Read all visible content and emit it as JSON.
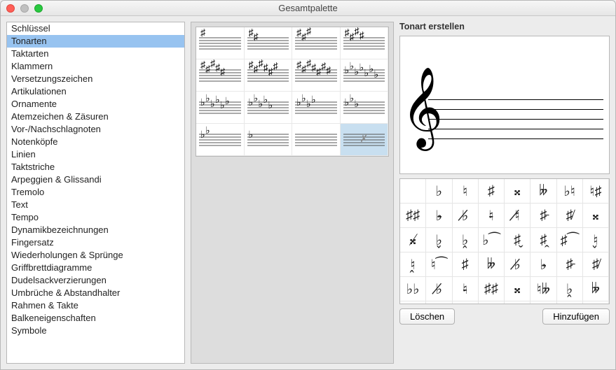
{
  "window": {
    "title": "Gesamtpalette"
  },
  "sidebar": {
    "items": [
      {
        "label": "Schlüssel",
        "selected": false
      },
      {
        "label": "Tonarten",
        "selected": true
      },
      {
        "label": "Taktarten",
        "selected": false
      },
      {
        "label": "Klammern",
        "selected": false
      },
      {
        "label": "Versetzungszeichen",
        "selected": false
      },
      {
        "label": "Artikulationen",
        "selected": false
      },
      {
        "label": "Ornamente",
        "selected": false
      },
      {
        "label": "Atemzeichen & Zäsuren",
        "selected": false
      },
      {
        "label": "Vor-/Nachschlagnoten",
        "selected": false
      },
      {
        "label": "Notenköpfe",
        "selected": false
      },
      {
        "label": "Linien",
        "selected": false
      },
      {
        "label": "Taktstriche",
        "selected": false
      },
      {
        "label": "Arpeggien & Glissandi",
        "selected": false
      },
      {
        "label": "Tremolo",
        "selected": false
      },
      {
        "label": "Text",
        "selected": false
      },
      {
        "label": "Tempo",
        "selected": false
      },
      {
        "label": "Dynamikbezeichnungen",
        "selected": false
      },
      {
        "label": "Fingersatz",
        "selected": false
      },
      {
        "label": "Wiederholungen & Sprünge",
        "selected": false
      },
      {
        "label": "Griffbrettdiagramme",
        "selected": false
      },
      {
        "label": "Dudelsackverzierungen",
        "selected": false
      },
      {
        "label": "Umbrüche & Abstandhalter",
        "selected": false
      },
      {
        "label": "Rahmen & Takte",
        "selected": false
      },
      {
        "label": "Balkeneigenschaften",
        "selected": false
      },
      {
        "label": "Symbole",
        "selected": false
      }
    ]
  },
  "palette": {
    "cells": [
      {
        "type": "sharp",
        "count": 1,
        "selected": false
      },
      {
        "type": "sharp",
        "count": 2,
        "selected": false
      },
      {
        "type": "sharp",
        "count": 3,
        "selected": false
      },
      {
        "type": "sharp",
        "count": 4,
        "selected": false
      },
      {
        "type": "sharp",
        "count": 5,
        "selected": false
      },
      {
        "type": "sharp",
        "count": 6,
        "selected": false
      },
      {
        "type": "sharp",
        "count": 7,
        "selected": false
      },
      {
        "type": "flat",
        "count": 7,
        "selected": false
      },
      {
        "type": "flat",
        "count": 6,
        "selected": false
      },
      {
        "type": "flat",
        "count": 5,
        "selected": false
      },
      {
        "type": "flat",
        "count": 4,
        "selected": false
      },
      {
        "type": "flat",
        "count": 3,
        "selected": false
      },
      {
        "type": "flat",
        "count": 2,
        "selected": false
      },
      {
        "type": "flat",
        "count": 1,
        "selected": false
      },
      {
        "type": "none",
        "count": 0,
        "selected": false
      },
      {
        "type": "custom",
        "count": 0,
        "selected": true
      }
    ]
  },
  "editor": {
    "heading": "Tonart erstellen",
    "clef_glyph": "𝄞"
  },
  "acc_picker": {
    "glyphs": [
      "",
      "♭",
      "♮",
      "♯",
      "𝄪",
      "𝄫",
      "♭♮",
      "♮♯",
      "♯♯",
      "♭̵",
      "♭̸",
      "♮̵",
      "♮̸",
      "♯̵",
      "♯̸",
      "𝄪̵",
      "𝄪̸",
      "♭̬",
      "♭̭",
      "♭⁀",
      "♯̬",
      "♯̭",
      "♯⁀",
      "♮̬",
      "♮̭",
      "♮⁀",
      "♯",
      "𝄫",
      "♭̸",
      "♭̵",
      "♯̵",
      "♯̸",
      "♭♭",
      "♭̸",
      "♮̵",
      "♯♯",
      "𝄪̵",
      "♮𝄫",
      "♭̭",
      "𝄫̵",
      "",
      "",
      "",
      "",
      "",
      "",
      "",
      ""
    ]
  },
  "buttons": {
    "delete": "Löschen",
    "add": "Hinzufügen"
  }
}
